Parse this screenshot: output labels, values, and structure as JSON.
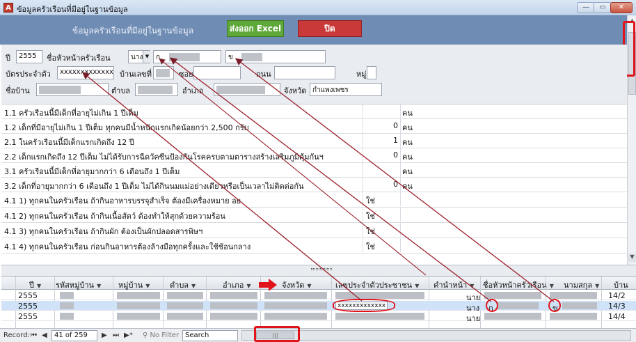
{
  "window": {
    "title": "ข้อมูลครัวเรือนที่มีอยู่ในฐานข้อมูล",
    "app_icon": "A",
    "controls": {
      "minimize": "—",
      "maximize": "▭",
      "close": "✕"
    }
  },
  "header": {
    "title": "ข้อมูลครัวเรือนที่มีอยู่ในฐานข้อมูล",
    "excel_button": "ส่งออก Excel",
    "close_button": "ปิด"
  },
  "form": {
    "year_label": "ปี",
    "year_value": "2555",
    "head_name_label": "ชื่อหัวหน้าครัวเรือน",
    "prefix_value": "นาง",
    "first_name_value": "ก",
    "last_name_value": "ข",
    "id_label": "บัตรประจำตัว",
    "id_value": "xxxxxxxxxxxxx",
    "house_no_label": "บ้านเลขที่",
    "soi_label": "ซอย",
    "road_label": "ถนน",
    "moo_label": "หมู่",
    "village_label": "ชื่อบ้าน",
    "tambon_label": "ตำบล",
    "amphoe_label": "อำเภอ",
    "province_label": "จังหวัด",
    "province_value": "กำแพงเพชร"
  },
  "checklist": [
    {
      "question": "1.1 ครัวเรือนนี้มีเด็กที่อายุไม่เกิน 1 ปีเต็ม",
      "value": "",
      "unit": "คน"
    },
    {
      "question": "1.2 เด็กที่มีอายุไม่เกิน 1 ปีเต็ม ทุกคนมีน้ำหนักแรกเกิดน้อยกว่า 2,500 กรัม",
      "value": "0",
      "unit": "คน"
    },
    {
      "question": "2.1 ในครัวเรือนนี้มีเด็กแรกเกิดถึง 12 ปี",
      "value": "1",
      "unit": "คน"
    },
    {
      "question": "2.2 เด็กแรกเกิดถึง 12 ปีเต็ม ไม่ได้รับการฉีดวัคซีนป้องกันโรคครบตามตารางสร้างเสริมภูมิคุ้มกันฯ",
      "value": "0",
      "unit": "คน"
    },
    {
      "question": "3.1 ครัวเรือนนี้มีเด็กที่อายุมากกว่า 6 เดือนถึง 1 ปีเต็ม",
      "value": "",
      "unit": "คน"
    },
    {
      "question": "3.2 เด็กที่อายุมากกว่า 6 เดือนถึง 1 ปีเต็ม ไม่ได้กินนมแม่อย่างเดียวหรือเป็นเวลาไม่ติดต่อกัน",
      "value": "0",
      "unit": "คน"
    },
    {
      "question": "4.1 1) ทุกคนในครัวเรือน ถ้ากินอาหารบรรจุสำเร็จ ต้องมีเครื่องหมาย อย.",
      "answer": "ใช่"
    },
    {
      "question": "4.1 2) ทุกคนในครัวเรือน ถ้ากินเนื้อสัตว์ ต้องทำให้สุกด้วยความร้อน",
      "answer": "ใช่"
    },
    {
      "question": "4.1 3) ทุกคนในครัวเรือน ถ้ากินผัก ต้องเป็นผักปลอดสารพิษฯ",
      "answer": "ใช่"
    },
    {
      "question": "4.1 4) ทุกคนในครัวเรือน ก่อนกินอาหารต้องล้างมือทุกครั้งและใช้ช้อนกลาง",
      "answer": "ใช่"
    }
  ],
  "grid": {
    "columns": [
      "ปี",
      "รหัสหมู่บ้าน",
      "หมู่บ้าน",
      "ตำบล",
      "อำเภอ",
      "จังหวัด",
      "เลขประจำตัวประชาชน",
      "คำนำหน้า",
      "ชื่อหัวหน้าครัวเรือน",
      "นามสกุล",
      "บ้าน"
    ],
    "rows": [
      {
        "year": "2555",
        "id": "",
        "prefix": "นาย",
        "first": "",
        "last": "",
        "house": "14/2"
      },
      {
        "year": "2555",
        "id": "xxxxxxxxxxxxx",
        "prefix": "นาง",
        "first": "ก",
        "last": "ข",
        "house": "14/3"
      },
      {
        "year": "2555",
        "id": "",
        "prefix": "นาย",
        "first": "",
        "last": "",
        "house": "14/4"
      }
    ]
  },
  "status": {
    "record_label": "Record:",
    "nav_first": "⏮",
    "nav_prev": "◀",
    "record_text": "41 of 259",
    "nav_next": "▶",
    "nav_last": "⏭",
    "nav_new": "▶*",
    "filter_text": "No Filter",
    "search_text": "Search"
  },
  "colors": {
    "header_bg": "#6f8db4",
    "excel_green": "#5fa83a",
    "close_red": "#c9393a",
    "annotation_red": "#e0141a",
    "arrow_line": "#9b1f2a"
  }
}
